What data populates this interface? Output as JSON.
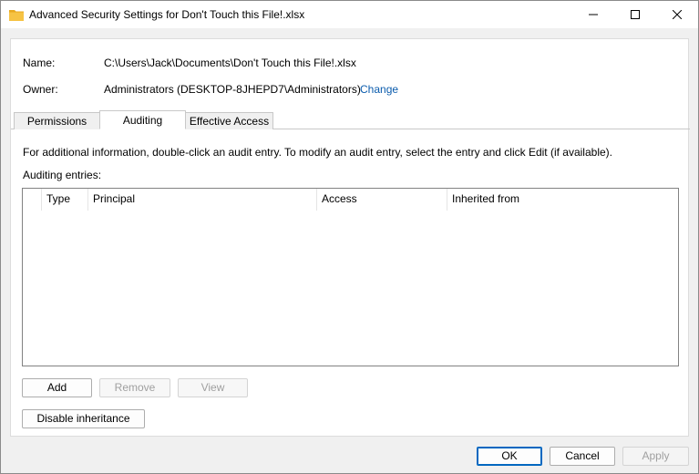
{
  "window": {
    "title": "Advanced Security Settings for Don't Touch this File!.xlsx"
  },
  "info": {
    "name_label": "Name:",
    "name_value": "C:\\Users\\Jack\\Documents\\Don't Touch this File!.xlsx",
    "owner_label": "Owner:",
    "owner_value": "Administrators (DESKTOP-8JHEPD7\\Administrators)",
    "change_link": "Change"
  },
  "tabs": [
    {
      "label": "Permissions",
      "active": false
    },
    {
      "label": "Auditing",
      "active": true
    },
    {
      "label": "Effective Access",
      "active": false
    }
  ],
  "auditing": {
    "instructions": "For additional information, double-click an audit entry. To modify an audit entry, select the entry and click Edit (if available).",
    "entries_label": "Auditing entries:",
    "columns": [
      "Type",
      "Principal",
      "Access",
      "Inherited from"
    ],
    "rows": []
  },
  "buttons": {
    "add": "Add",
    "remove": "Remove",
    "view": "View",
    "disable_inheritance": "Disable inheritance",
    "ok": "OK",
    "cancel": "Cancel",
    "apply": "Apply"
  },
  "colors": {
    "link": "#0b5cad",
    "folder_icon": "#f6c344",
    "default_button_border": "#0067c0"
  }
}
